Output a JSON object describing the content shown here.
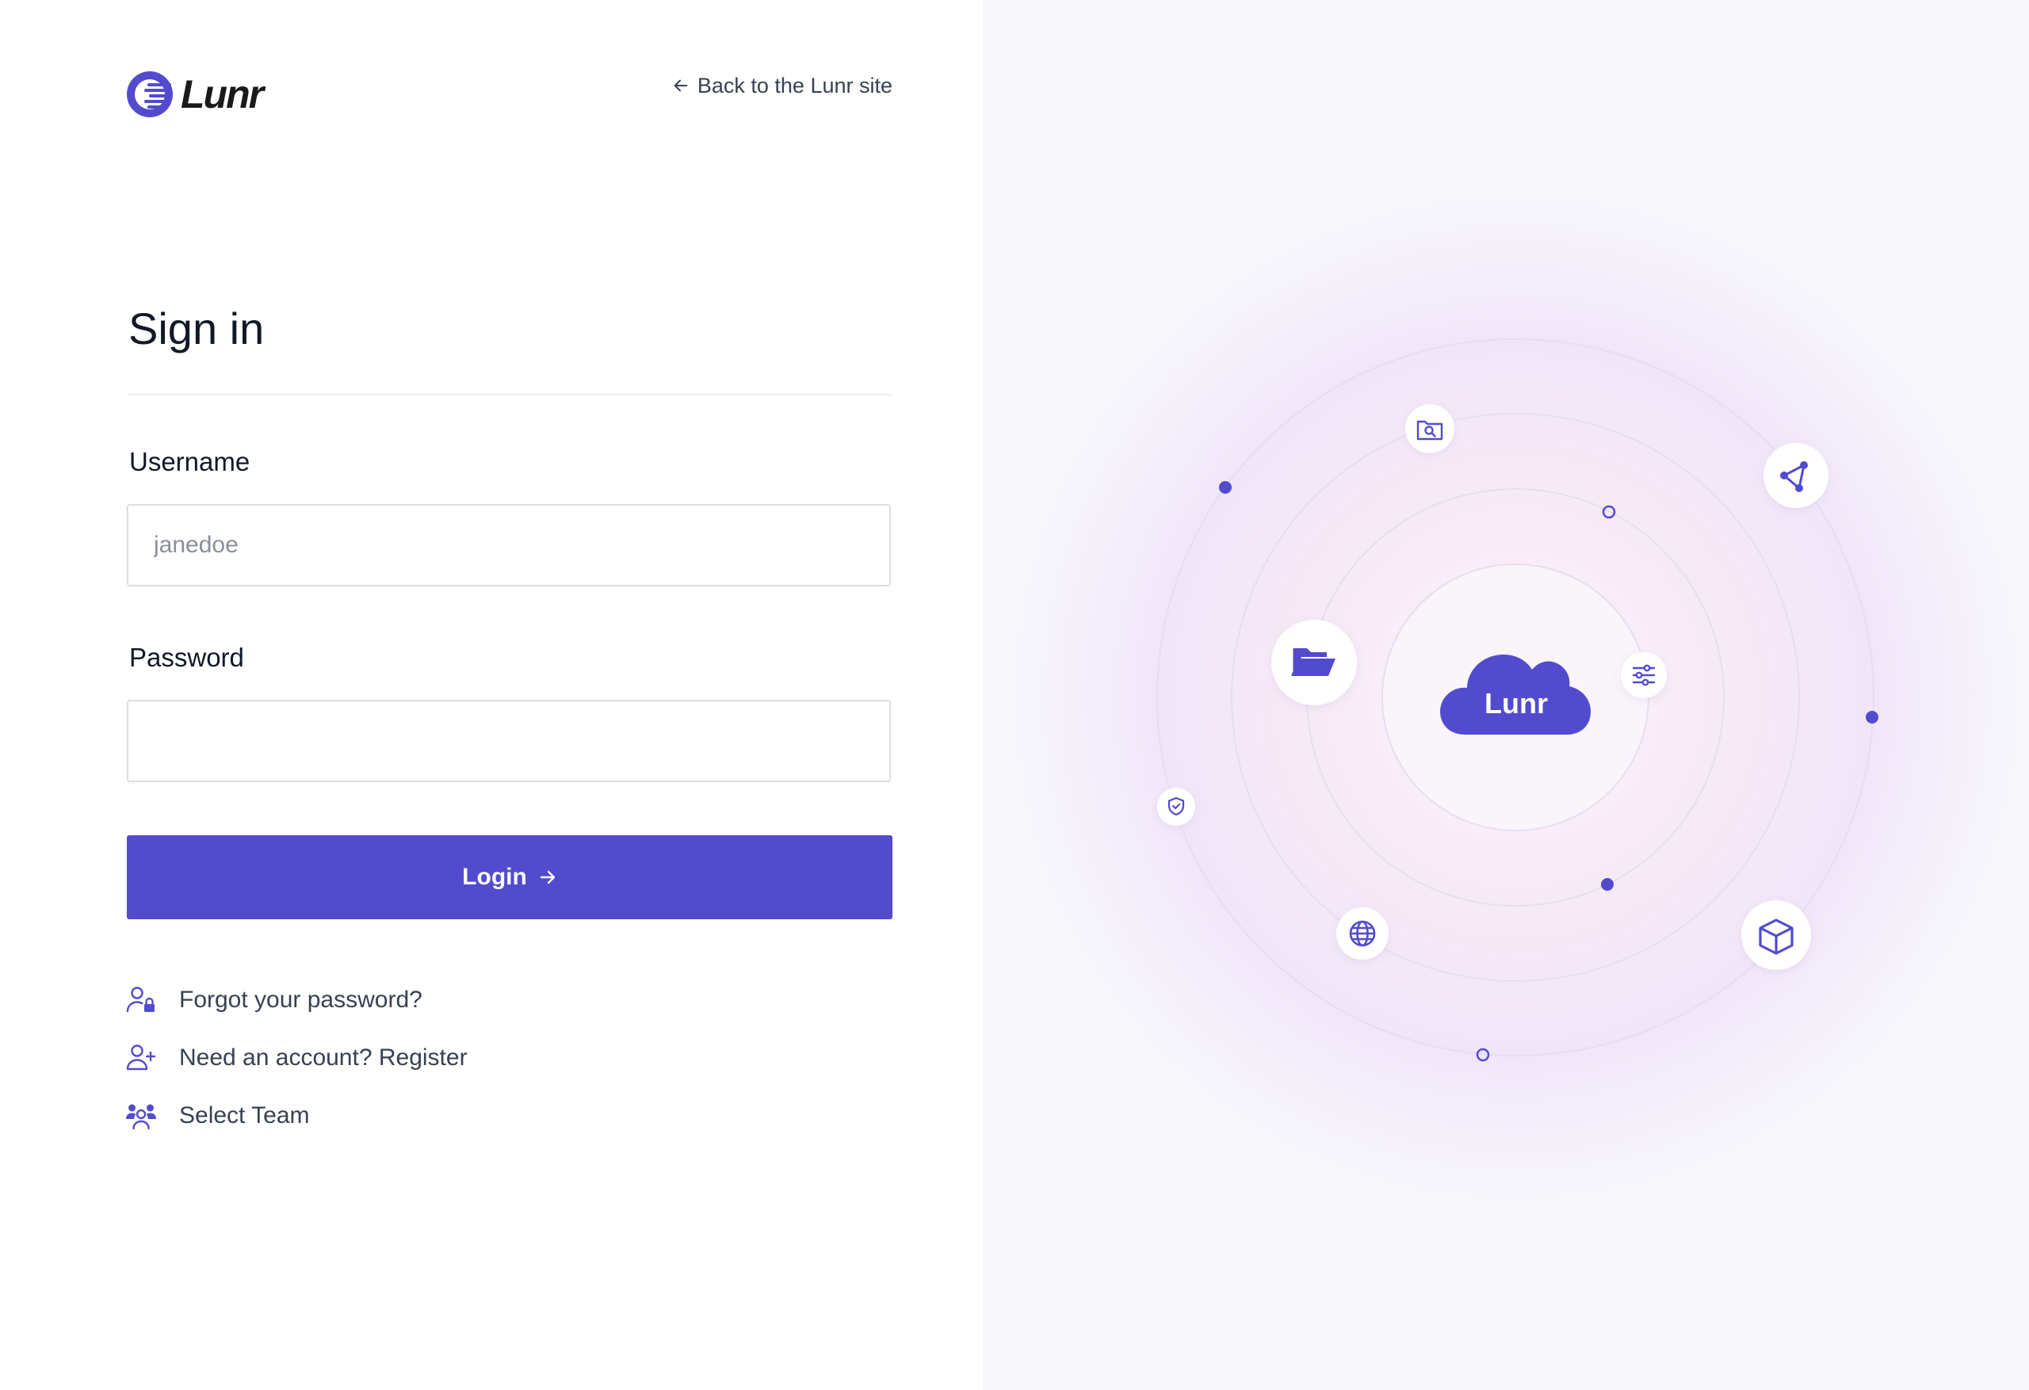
{
  "brand": {
    "name": "Lunr",
    "accent_color": "#524bcd"
  },
  "header": {
    "back_link_label": "Back to the Lunr site"
  },
  "form": {
    "title": "Sign in",
    "username": {
      "label": "Username",
      "placeholder": "janedoe",
      "value": ""
    },
    "password": {
      "label": "Password",
      "value": ""
    },
    "submit_label": "Login"
  },
  "links": [
    {
      "label": "Forgot your password?",
      "icon": "user-lock-icon"
    },
    {
      "label": "Need an account? Register",
      "icon": "user-plus-icon"
    },
    {
      "label": "Select Team",
      "icon": "users-group-icon"
    }
  ],
  "illustration": {
    "center_label": "Lunr",
    "icons": [
      "folder-search-icon",
      "share-nodes-icon",
      "folder-open-icon",
      "sliders-icon",
      "shield-check-icon",
      "globe-icon",
      "cube-icon",
      "cloud-icon"
    ]
  }
}
